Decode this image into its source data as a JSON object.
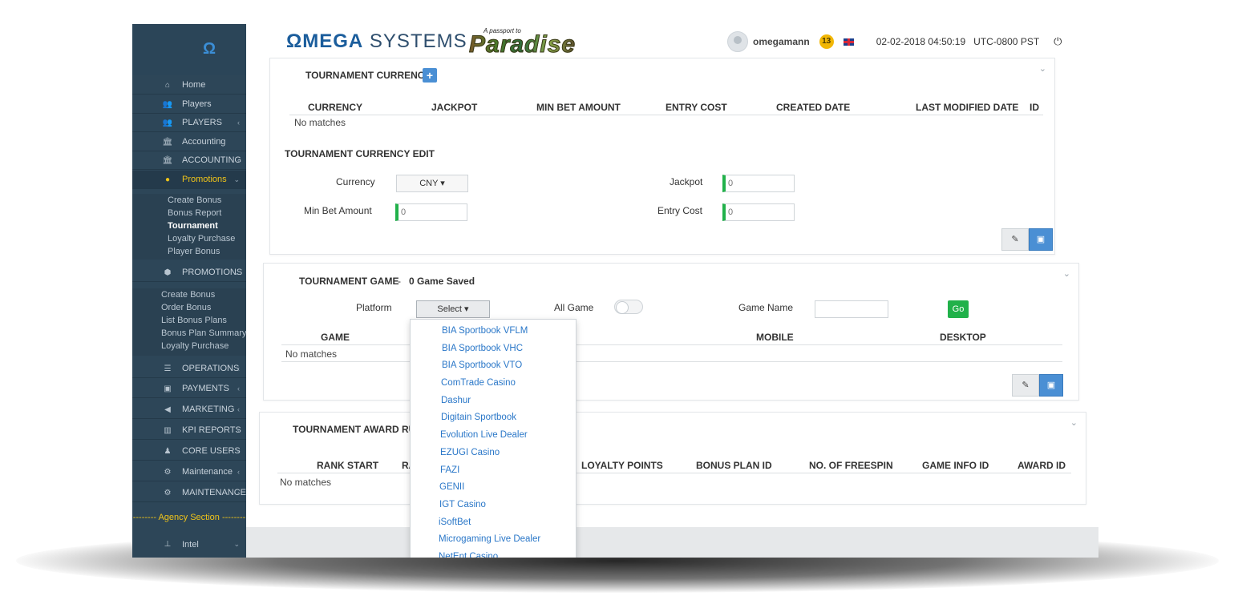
{
  "sidebar": {
    "items": [
      {
        "label": "Home",
        "icon": "home-icon"
      },
      {
        "label": "Players",
        "icon": "users-icon"
      },
      {
        "label": "PLAYERS",
        "icon": "users-icon"
      },
      {
        "label": "Accounting",
        "icon": "bank-icon"
      },
      {
        "label": "ACCOUNTING",
        "icon": "bank-icon"
      },
      {
        "label": "Promotions",
        "icon": "tag-icon"
      }
    ],
    "promotions_sub": [
      "Create Bonus",
      "Bonus Report",
      "Tournament",
      "Loyalty Purchase",
      "Player Bonus"
    ],
    "promotions_upper": {
      "label": "PROMOTIONS",
      "icon": "tags-icon"
    },
    "promotions_upper_sub": [
      "Create Bonus",
      "Order Bonus",
      "List Bonus Plans",
      "Bonus Plan Summary",
      "Loyalty Purchase"
    ],
    "lower_items": [
      {
        "label": "OPERATIONS",
        "icon": "list-icon"
      },
      {
        "label": "PAYMENTS",
        "icon": "money-icon"
      },
      {
        "label": "MARKETING",
        "icon": "megaphone-icon"
      },
      {
        "label": "KPI REPORTS",
        "icon": "bar-chart-icon"
      },
      {
        "label": "CORE USERS",
        "icon": "user-plus-icon"
      },
      {
        "label": "Maintenance",
        "icon": "cogs-icon"
      },
      {
        "label": "MAINTENANCE",
        "icon": "cogs-icon"
      }
    ],
    "agency_section": "-------- Agency Section --------",
    "intel": {
      "label": "Intel",
      "icon": "sitemap-icon"
    }
  },
  "header": {
    "brand_omega": "ΩMEGA",
    "brand_systems": " SYSTEMS",
    "paradise_small": "A passport to",
    "paradise_big": "Paradise",
    "username": "omegamann",
    "notifications": "13",
    "datetime": "02-02-2018 04:50:19",
    "timezone": "UTC-0800 PST"
  },
  "currency_panel": {
    "title": "TOURNAMENT CURRENCY",
    "columns": [
      "CURRENCY",
      "JACKPOT",
      "MIN BET AMOUNT",
      "ENTRY COST",
      "CREATED DATE",
      "LAST MODIFIED DATE",
      "ID"
    ],
    "no_matches": "No matches",
    "edit_title": "TOURNAMENT CURRENCY EDIT",
    "currency_label": "Currency",
    "currency_value": "CNY",
    "jackpot_label": "Jackpot",
    "jackpot_value": "0",
    "min_bet_label": "Min Bet Amount",
    "min_bet_value": "0",
    "entry_cost_label": "Entry Cost",
    "entry_cost_value": "0"
  },
  "game_panel": {
    "title": "TOURNAMENT GAME",
    "separator": "-",
    "saved": "0 Game Saved",
    "platform_label": "Platform",
    "platform_value": "Select",
    "all_game_label": "All Game",
    "game_name_label": "Game Name",
    "go_label": "Go",
    "columns": [
      "GAME",
      "MOBILE",
      "DESKTOP"
    ],
    "no_matches": "No matches"
  },
  "award_panel": {
    "title": "TOURNAMENT AWARD RUL",
    "columns": [
      "RANK START",
      "RA",
      "LOYALTY POINTS",
      "BONUS PLAN ID",
      "NO. OF FREESPIN",
      "GAME INFO ID",
      "AWARD ID"
    ],
    "no_matches": "No matches"
  },
  "platform_dropdown": [
    "BIA Sportbook VFLM",
    "BIA Sportbook VHC",
    "BIA Sportbook VTO",
    "ComTrade Casino",
    "Dashur",
    "Digitain Sportbook",
    "Evolution Live Dealer",
    "EZUGI Casino",
    "FAZI",
    "GENII",
    "IGT Casino",
    "iSoftBet",
    "Microgaming Live Dealer",
    "NetEnt Casino"
  ],
  "colors": {
    "sidebar": "#2d4658",
    "accent_blue": "#4a8fd4",
    "go_green": "#21b14a",
    "active_yellow": "#f0c419",
    "link_blue": "#2a77c8"
  }
}
